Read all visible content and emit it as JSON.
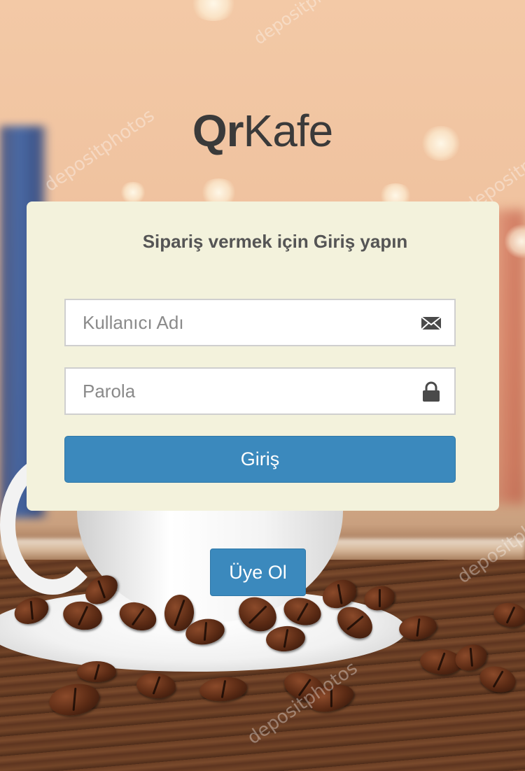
{
  "brand": {
    "logo_bold": "Qr",
    "logo_light": "Kafe"
  },
  "login_card": {
    "title": "Sipariş vermek için Giriş yapın",
    "username": {
      "placeholder": "Kullanıcı Adı",
      "value": "",
      "icon": "envelope-icon"
    },
    "password": {
      "placeholder": "Parola",
      "value": "",
      "icon": "lock-icon"
    },
    "login_label": "Giriş"
  },
  "signup": {
    "label": "Üye Ol"
  },
  "watermark": "depositphotos",
  "colors": {
    "accent": "#3b89bd",
    "card_bg": "#f3f2dc",
    "logo_text": "#3a3a3a",
    "title_text": "#555555"
  }
}
